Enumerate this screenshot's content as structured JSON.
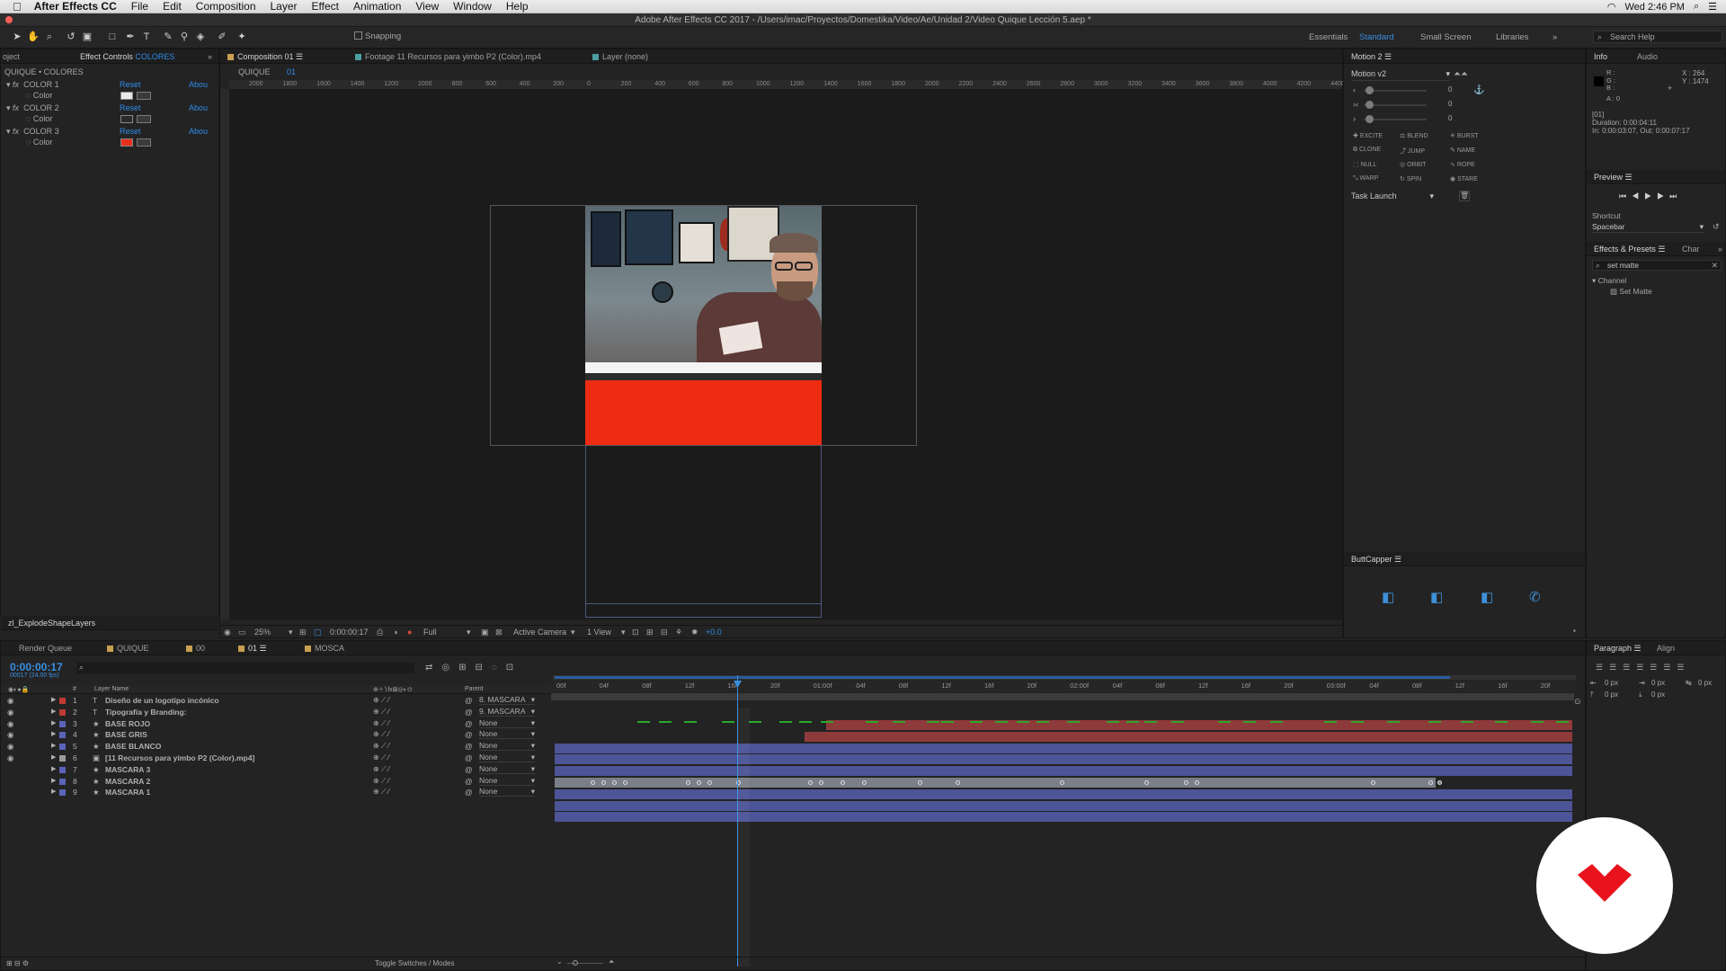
{
  "menubar": {
    "app": "After Effects CC",
    "items": [
      "File",
      "Edit",
      "Composition",
      "Layer",
      "Effect",
      "Animation",
      "View",
      "Window",
      "Help"
    ],
    "clock": "Wed 2:46 PM"
  },
  "titlebar": {
    "title": "Adobe After Effects CC 2017 - /Users/imac/Proyectos/Domestika/Video/Ae/Unidad 2/Video Quique Lección 5.aep *"
  },
  "toolbar": {
    "snapping_label": "Snapping",
    "workspaces": [
      "Essentials",
      "Standard",
      "Small Screen",
      "Libraries"
    ],
    "search_placeholder": "Search Help"
  },
  "effect_controls": {
    "tab_project": "oject",
    "tab_label": "Effect Controls",
    "tab_layer": "COLORES",
    "breadcrumb": "QUIQUE • COLORES",
    "effects": [
      {
        "name": "COLOR 1",
        "reset": "Reset",
        "about": "Abou",
        "prop": "Color",
        "color": "#e8e8e8"
      },
      {
        "name": "COLOR 2",
        "reset": "Reset",
        "about": "Abou",
        "prop": "Color",
        "color": "#2a2a2a"
      },
      {
        "name": "COLOR 3",
        "reset": "Reset",
        "about": "Abou",
        "prop": "Color",
        "color": "#e8301b"
      }
    ],
    "bottom_panel": "zl_ExplodeShapeLayers"
  },
  "composition": {
    "tabs": [
      "Composition 01",
      "Footage 11 Recursos para yimbo P2 (Color).mp4",
      "Layer (none)"
    ],
    "breadcrumbs": [
      "QUIQUE",
      "01"
    ],
    "ruler_labels": [
      "2000",
      "1800",
      "1600",
      "1400",
      "1200",
      "1000",
      "800",
      "600",
      "400",
      "200",
      "0",
      "200",
      "400",
      "600",
      "800",
      "1000",
      "1200",
      "1400",
      "1600",
      "1800",
      "2000",
      "2200",
      "2400",
      "2600",
      "2800",
      "3000",
      "3200",
      "3400",
      "3600",
      "3800",
      "4000",
      "4200",
      "4400"
    ],
    "footer": {
      "zoom": "25%",
      "timecode": "0:00:00:17",
      "resolution": "Full",
      "camera": "Active Camera",
      "views": "1 View",
      "exposure": "+0.0"
    },
    "red_color": "#ee2c11"
  },
  "motion": {
    "tab": "Motion 2",
    "dropdown": "Motion v2",
    "slider_values": [
      "0",
      "0",
      "0"
    ],
    "buttons": [
      "EXCITE",
      "BLEND",
      "BURST",
      "CLONE",
      "JUMP",
      "NAME",
      "NULL",
      "ORBIT",
      "ROPE",
      "WARP",
      "SPIN",
      "STARE"
    ],
    "task": "Task Launch",
    "buttcapper": "ButtCapper"
  },
  "info": {
    "tabs": [
      "Info",
      "Audio"
    ],
    "rgb": [
      "R :",
      "G :",
      "B :",
      "A : 0"
    ],
    "coords": [
      "X : 264",
      "Y : 1474"
    ],
    "layer": "[01]",
    "duration": "Duration: 0:00:04:11",
    "inout": "In: 0:00:03:07, Out: 0:00:07:17",
    "preview": "Preview",
    "shortcut_label": "Shortcut",
    "shortcut": "Spacebar",
    "effects_tabs": [
      "Effects & Presets",
      "Char"
    ],
    "effects_search": "set matte",
    "category": "Channel",
    "result": "Set Matte"
  },
  "timeline": {
    "tabs": [
      "Render Queue",
      "QUIQUE",
      "00",
      "01",
      "MOSCA"
    ],
    "timecode": "0:00:00:17",
    "fps": "00017 (24.00 fps)",
    "col_headers": [
      "#",
      "Layer Name",
      "Parent"
    ],
    "layers": [
      {
        "num": "1",
        "type": "T",
        "name": "Diseño de un logotipo incónico",
        "parent": "8. MASCARA",
        "color": "#c03a33"
      },
      {
        "num": "2",
        "type": "T",
        "name": "Tipografía y Branding:",
        "parent": "9. MASCARA",
        "color": "#c03a33"
      },
      {
        "num": "3",
        "type": "★",
        "name": "BASE ROJO",
        "parent": "None",
        "color": "#5b63b8"
      },
      {
        "num": "4",
        "type": "★",
        "name": "BASE GRIS",
        "parent": "None",
        "color": "#5b63b8"
      },
      {
        "num": "5",
        "type": "★",
        "name": "BASE BLANCO",
        "parent": "None",
        "color": "#5b63b8"
      },
      {
        "num": "6",
        "type": "▣",
        "name": "[11 Recursos para yimbo P2 (Color).mp4]",
        "parent": "None",
        "color": "#9a9a9a"
      },
      {
        "num": "7",
        "type": "★",
        "name": "MASCARA 3",
        "parent": "None",
        "color": "#5b63b8"
      },
      {
        "num": "8",
        "type": "★",
        "name": "MASCARA 2",
        "parent": "None",
        "color": "#5b63b8"
      },
      {
        "num": "9",
        "type": "★",
        "name": "MASCARA 1",
        "parent": "None",
        "color": "#5b63b8"
      }
    ],
    "ruler": [
      "00f",
      "04f",
      "08f",
      "12f",
      "16f",
      "20f",
      "01:00f",
      "04f",
      "08f",
      "12f",
      "16f",
      "20f",
      "02:00f",
      "04f",
      "08f",
      "12f",
      "16f",
      "20f",
      "03:00f",
      "04f",
      "08f",
      "12f",
      "16f",
      "20f"
    ],
    "toggle_label": "Toggle Switches / Modes"
  },
  "paragraph": {
    "tabs": [
      "Paragraph",
      "Align"
    ],
    "values": [
      "0 px",
      "0 px",
      "0 px",
      "0 px",
      "0 px"
    ]
  }
}
